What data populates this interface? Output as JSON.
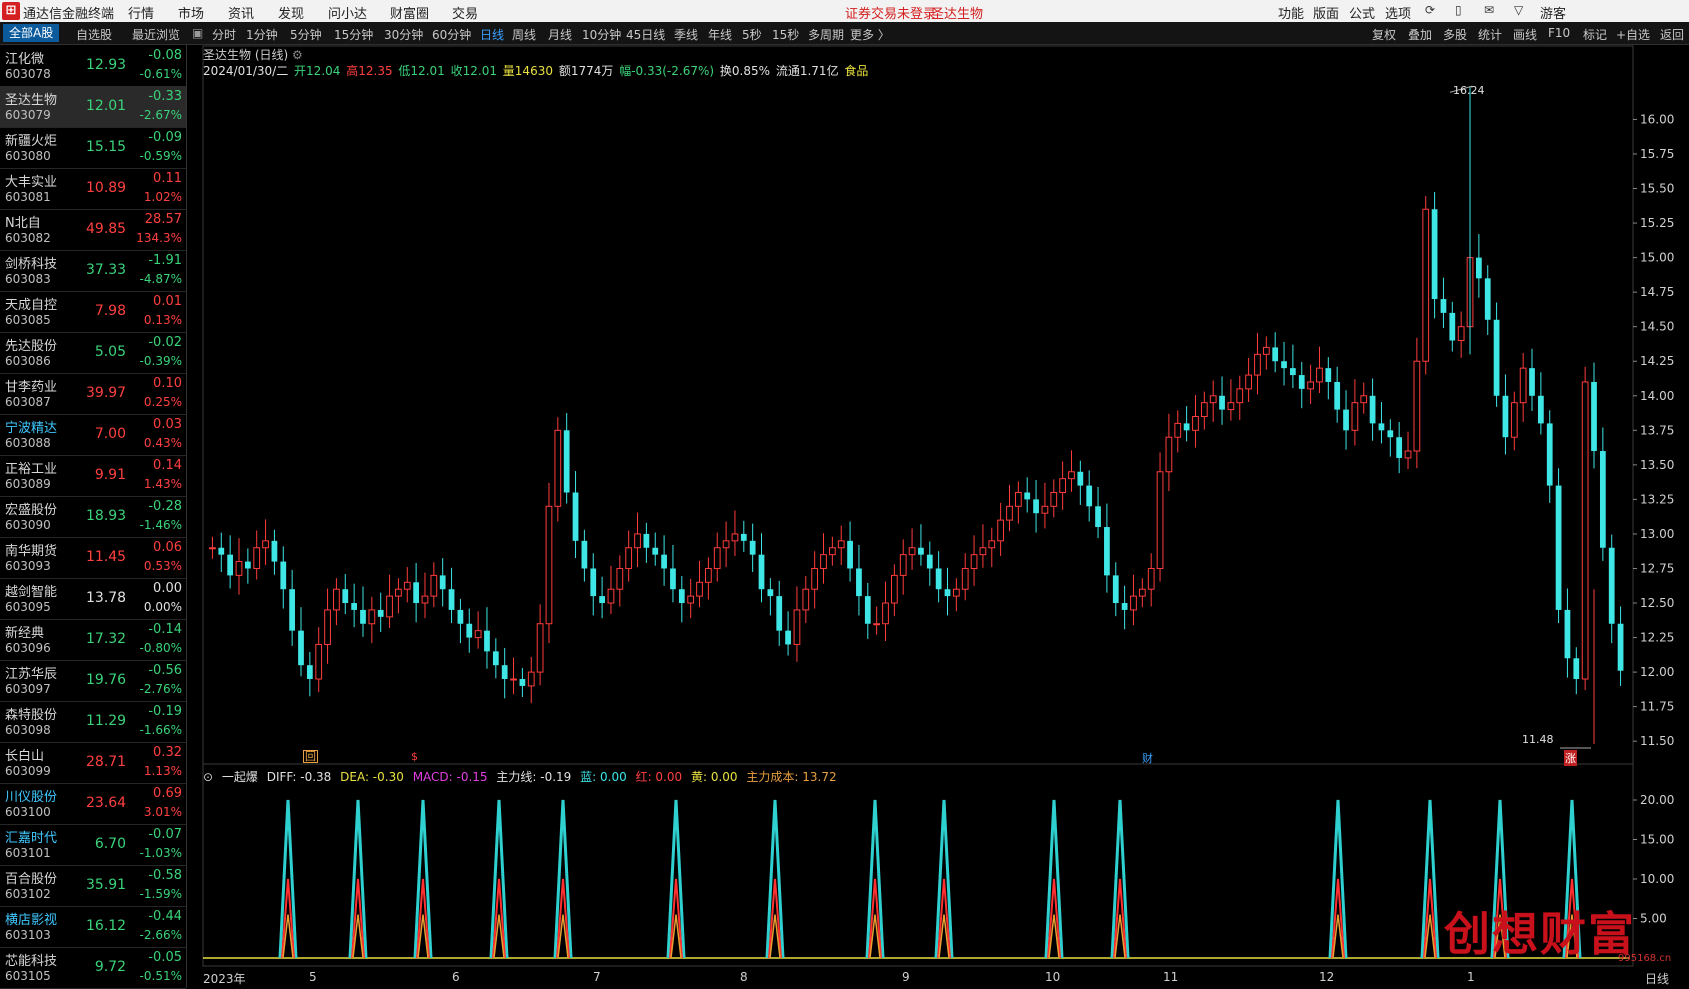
{
  "menubar": {
    "app_name": "通达信金融终端",
    "menus": [
      "行情",
      "市场",
      "资讯",
      "发现",
      "问小达",
      "财富圈",
      "交易"
    ],
    "notice": "证券交易未登录",
    "current_stock": "圣达生物",
    "right_menus": [
      "功能",
      "版面",
      "公式",
      "选项"
    ],
    "user": "游客"
  },
  "toolbar": {
    "tabs": [
      "全部A股",
      "自选股",
      "最近浏览"
    ],
    "periods": [
      "分时",
      "1分钟",
      "5分钟",
      "15分钟",
      "30分钟",
      "60分钟",
      "日线",
      "周线",
      "月线",
      "10分钟",
      "45日线",
      "季线",
      "年线",
      "5秒",
      "15秒",
      "多周期",
      "更多 〉"
    ],
    "active_period": "日线",
    "right_tools": [
      "复权",
      "叠加",
      "多股",
      "统计",
      "画线",
      "F10",
      "标记",
      "+自选",
      "返回"
    ]
  },
  "stocks": [
    {
      "name": "江化微",
      "code": "603078",
      "price": "12.93",
      "change": "-0.08",
      "pct": "-0.61%",
      "dir": "dn"
    },
    {
      "name": "圣达生物",
      "code": "603079",
      "price": "12.01",
      "change": "-0.33",
      "pct": "-2.67%",
      "dir": "dn",
      "selected": true
    },
    {
      "name": "新疆火炬",
      "code": "603080",
      "price": "15.15",
      "change": "-0.09",
      "pct": "-0.59%",
      "dir": "dn"
    },
    {
      "name": "大丰实业",
      "code": "603081",
      "price": "10.89",
      "change": "0.11",
      "pct": "1.02%",
      "dir": "up"
    },
    {
      "name": "N北自",
      "code": "603082",
      "price": "49.85",
      "change": "28.57",
      "pct": "134.3%",
      "dir": "up"
    },
    {
      "name": "剑桥科技",
      "code": "603083",
      "price": "37.33",
      "change": "-1.91",
      "pct": "-4.87%",
      "dir": "dn"
    },
    {
      "name": "天成自控",
      "code": "603085",
      "price": "7.98",
      "change": "0.01",
      "pct": "0.13%",
      "dir": "up"
    },
    {
      "name": "先达股份",
      "code": "603086",
      "price": "5.05",
      "change": "-0.02",
      "pct": "-0.39%",
      "dir": "dn"
    },
    {
      "name": "甘李药业",
      "code": "603087",
      "price": "39.97",
      "change": "0.10",
      "pct": "0.25%",
      "dir": "up"
    },
    {
      "name": "宁波精达",
      "code": "603088",
      "price": "7.00",
      "change": "0.03",
      "pct": "0.43%",
      "dir": "up",
      "cyan": true
    },
    {
      "name": "正裕工业",
      "code": "603089",
      "price": "9.91",
      "change": "0.14",
      "pct": "1.43%",
      "dir": "up"
    },
    {
      "name": "宏盛股份",
      "code": "603090",
      "price": "18.93",
      "change": "-0.28",
      "pct": "-1.46%",
      "dir": "dn"
    },
    {
      "name": "南华期货",
      "code": "603093",
      "price": "11.45",
      "change": "0.06",
      "pct": "0.53%",
      "dir": "up"
    },
    {
      "name": "越剑智能",
      "code": "603095",
      "price": "13.78",
      "change": "0.00",
      "pct": "0.00%",
      "dir": "fl"
    },
    {
      "name": "新经典",
      "code": "603096",
      "price": "17.32",
      "change": "-0.14",
      "pct": "-0.80%",
      "dir": "dn"
    },
    {
      "name": "江苏华辰",
      "code": "603097",
      "price": "19.76",
      "change": "-0.56",
      "pct": "-2.76%",
      "dir": "dn"
    },
    {
      "name": "森特股份",
      "code": "603098",
      "price": "11.29",
      "change": "-0.19",
      "pct": "-1.66%",
      "dir": "dn"
    },
    {
      "name": "长白山",
      "code": "603099",
      "price": "28.71",
      "change": "0.32",
      "pct": "1.13%",
      "dir": "up"
    },
    {
      "name": "川仪股份",
      "code": "603100",
      "price": "23.64",
      "change": "0.69",
      "pct": "3.01%",
      "dir": "up",
      "cyan": true
    },
    {
      "name": "汇嘉时代",
      "code": "603101",
      "price": "6.70",
      "change": "-0.07",
      "pct": "-1.03%",
      "dir": "dn",
      "cyan": true
    },
    {
      "name": "百合股份",
      "code": "603102",
      "price": "35.91",
      "change": "-0.58",
      "pct": "-1.59%",
      "dir": "dn"
    },
    {
      "name": "横店影视",
      "code": "603103",
      "price": "16.12",
      "change": "-0.44",
      "pct": "-2.66%",
      "dir": "dn",
      "cyan": true
    },
    {
      "name": "芯能科技",
      "code": "603105",
      "price": "9.72",
      "change": "-0.05",
      "pct": "-0.51%",
      "dir": "dn"
    }
  ],
  "chart": {
    "title": "圣达生物 (日线)",
    "date": "2024/01/30/二",
    "open": "开12.04",
    "high": "高12.35",
    "low": "低12.01",
    "close": "收12.01",
    "volume": "量14630",
    "amount": "额1774万",
    "range": "幅-0.33(-2.67%)",
    "turnover": "换0.85%",
    "float_cap": "流通1.71亿",
    "sector": "食品",
    "max_label": "16.24",
    "min_label": "11.48",
    "markers": [
      "回",
      "$",
      "财",
      "涨"
    ],
    "colors": {
      "up": "#ff3c3c",
      "down": "#3ee6e6",
      "accent": "#3aa0ff"
    }
  },
  "indicator": {
    "name": "一起爆",
    "diff": "DIFF: -0.38",
    "dea": "DEA: -0.30",
    "macd": "MACD: -0.15",
    "main": "主力线: -0.19",
    "blue": "蓝: 0.00",
    "red": "红: 0.00",
    "yellow": "黄: 0.00",
    "cost": "主力成本: 13.72",
    "yticks": [
      "20.00",
      "15.00",
      "10.00",
      "5.00"
    ]
  },
  "xaxis": {
    "labels": [
      "2023年",
      "5",
      "6",
      "7",
      "8",
      "9",
      "10",
      "11",
      "12",
      "1"
    ],
    "period": "日线"
  },
  "watermark": {
    "text": "创想财富",
    "url": "995168.cn"
  },
  "chart_data": {
    "type": "candlestick",
    "title": "圣达生物 (日线)",
    "ylim": [
      11.4,
      16.3
    ],
    "yticks": [
      "16.00",
      "15.75",
      "15.50",
      "15.25",
      "15.00",
      "14.75",
      "14.50",
      "14.25",
      "14.00",
      "13.75",
      "13.50",
      "13.25",
      "13.00",
      "12.75",
      "12.50",
      "12.25",
      "12.00",
      "11.75",
      "11.50"
    ],
    "x_labels": [
      "2023年",
      "5",
      "6",
      "7",
      "8",
      "9",
      "10",
      "11",
      "12",
      "1"
    ],
    "close_series": [
      12.9,
      12.85,
      12.7,
      12.8,
      12.75,
      12.9,
      12.95,
      12.8,
      12.6,
      12.3,
      12.05,
      11.95,
      12.2,
      12.45,
      12.6,
      12.5,
      12.45,
      12.35,
      12.45,
      12.4,
      12.55,
      12.6,
      12.65,
      12.5,
      12.55,
      12.7,
      12.6,
      12.45,
      12.35,
      12.25,
      12.3,
      12.15,
      12.05,
      11.95,
      11.95,
      11.9,
      12.0,
      12.35,
      13.2,
      13.75,
      13.3,
      12.95,
      12.75,
      12.55,
      12.5,
      12.6,
      12.75,
      12.9,
      13.0,
      12.9,
      12.85,
      12.75,
      12.6,
      12.5,
      12.55,
      12.65,
      12.75,
      12.9,
      12.95,
      13.0,
      12.95,
      12.85,
      12.6,
      12.55,
      12.3,
      12.2,
      12.45,
      12.6,
      12.75,
      12.85,
      12.9,
      12.95,
      12.75,
      12.55,
      12.35,
      12.35,
      12.5,
      12.7,
      12.85,
      12.9,
      12.85,
      12.75,
      12.6,
      12.55,
      12.6,
      12.75,
      12.85,
      12.9,
      12.95,
      13.1,
      13.2,
      13.3,
      13.25,
      13.15,
      13.2,
      13.3,
      13.4,
      13.45,
      13.35,
      13.2,
      13.05,
      12.7,
      12.5,
      12.45,
      12.55,
      12.6,
      12.75,
      13.45,
      13.7,
      13.8,
      13.75,
      13.85,
      13.95,
      14.0,
      13.9,
      13.95,
      14.05,
      14.15,
      14.3,
      14.35,
      14.25,
      14.2,
      14.15,
      14.05,
      14.1,
      14.2,
      14.1,
      13.9,
      13.75,
      13.95,
      14.0,
      13.8,
      13.75,
      13.7,
      13.55,
      13.6,
      14.25,
      15.35,
      14.7,
      14.6,
      14.4,
      14.5,
      15.0,
      14.85,
      14.55,
      14.0,
      13.7,
      13.95,
      14.2,
      14.0,
      13.8,
      13.35,
      12.45,
      12.1,
      11.95,
      14.1,
      13.6,
      12.9,
      12.35,
      12.01
    ],
    "extremes": {
      "max": 16.24,
      "min": 11.48
    }
  }
}
